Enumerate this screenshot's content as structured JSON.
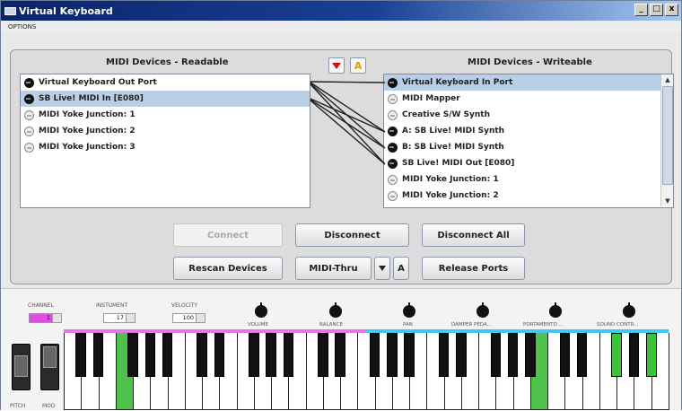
{
  "window": {
    "title": "Virtual Keyboard",
    "buttons": [
      "_",
      "□",
      "x"
    ]
  },
  "menu": {
    "options": "OPTIONS"
  },
  "readable": {
    "title": "MIDI Devices - Readable",
    "items": [
      {
        "label": "Virtual Keyboard Out Port",
        "active": true,
        "selected": false
      },
      {
        "label": "SB Live! MIDI In [E080]",
        "active": true,
        "selected": true
      },
      {
        "label": "MIDI Yoke Junction:  1",
        "active": false,
        "selected": false
      },
      {
        "label": "MIDI Yoke Junction:  2",
        "active": false,
        "selected": false
      },
      {
        "label": "MIDI Yoke Junction:  3",
        "active": false,
        "selected": false
      }
    ]
  },
  "writeable": {
    "title": "MIDI Devices - Writeable",
    "items": [
      {
        "label": "Virtual Keyboard In Port",
        "active": true,
        "selected": true
      },
      {
        "label": "MIDI Mapper",
        "active": false,
        "selected": false
      },
      {
        "label": "Creative S/W Synth",
        "active": false,
        "selected": false
      },
      {
        "label": "A: SB Live! MIDI Synth",
        "active": true,
        "selected": false
      },
      {
        "label": "B: SB Live! MIDI Synth",
        "active": true,
        "selected": false
      },
      {
        "label": "SB Live! MIDI Out [E080]",
        "active": true,
        "selected": false
      },
      {
        "label": "MIDI Yoke Junction:  1",
        "active": false,
        "selected": false
      },
      {
        "label": "MIDI Yoke Junction:  2",
        "active": false,
        "selected": false
      }
    ]
  },
  "buttons": {
    "connect": "Connect",
    "disconnect": "Disconnect",
    "disconnect_all": "Disconnect All",
    "rescan": "Rescan Devices",
    "midi_thru": "MIDI-Thru",
    "release": "Release Ports"
  },
  "controls": {
    "channel_label": "CHANNEL",
    "channel_value": "1",
    "instrument_label": "INSTUMENT",
    "instrument_value": "17",
    "velocity_label": "VELOCITY",
    "velocity_value": "100"
  },
  "knobs": [
    "VOLUME",
    "BALANCE",
    "PAN",
    "DAMPER PEDA...",
    "PORTAMENTO ...",
    "SOUND CONTR..."
  ],
  "wheels": {
    "pitch": "PITCH",
    "mod": "MOD"
  },
  "keyboard": {
    "pressed_white": [
      3,
      27
    ],
    "pressed_black": [
      22,
      24
    ]
  },
  "colors": {
    "title_bar": "#0a246a",
    "selection": "#b8cfe5",
    "pressed_key": "#4ec24a",
    "device_active": "#111111"
  }
}
